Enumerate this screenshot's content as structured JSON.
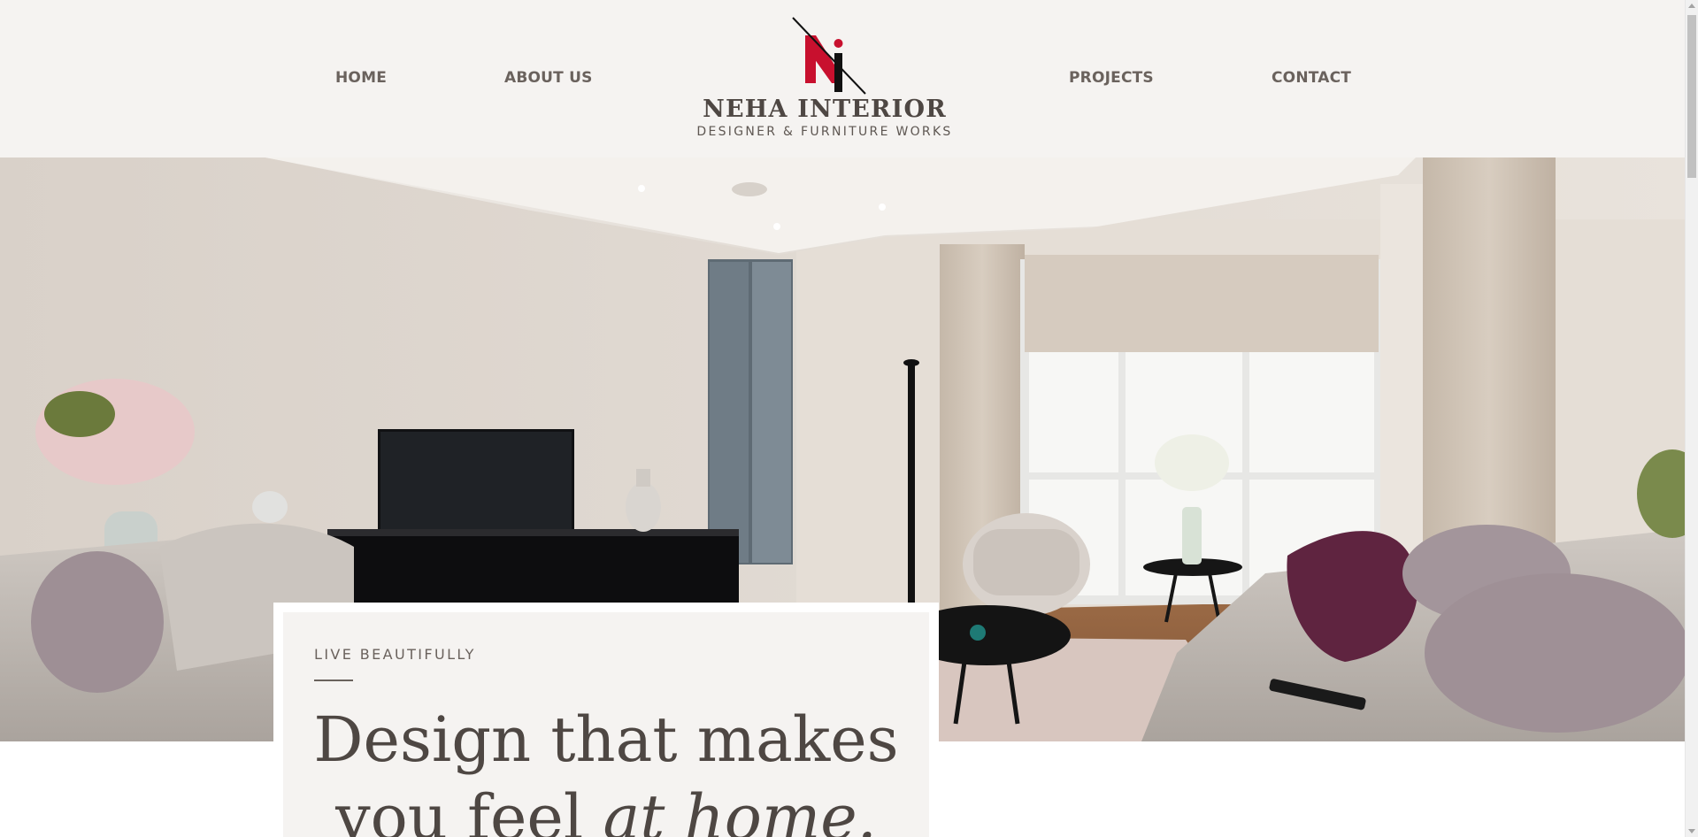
{
  "nav": {
    "home": "HOME",
    "about": "ABOUT US",
    "projects": "PROJECTS",
    "contact": "CONTACT"
  },
  "logo": {
    "name": "NEHA INTERIOR",
    "tagline": "DESIGNER & FURNITURE WORKS"
  },
  "hero": {
    "image_description_icon": "living-room-photo"
  },
  "card": {
    "eyebrow": "LIVE BEAUTIFULLY",
    "headline_line1": "Design that makes",
    "headline_line2_plain": "you feel ",
    "headline_line2_italic": "at home."
  },
  "colors": {
    "header_bg": "#f5f3f1",
    "text_dark": "#4e4743",
    "text_nav": "#6a625d",
    "brand_red": "#c8102e",
    "brand_black": "#111111"
  }
}
